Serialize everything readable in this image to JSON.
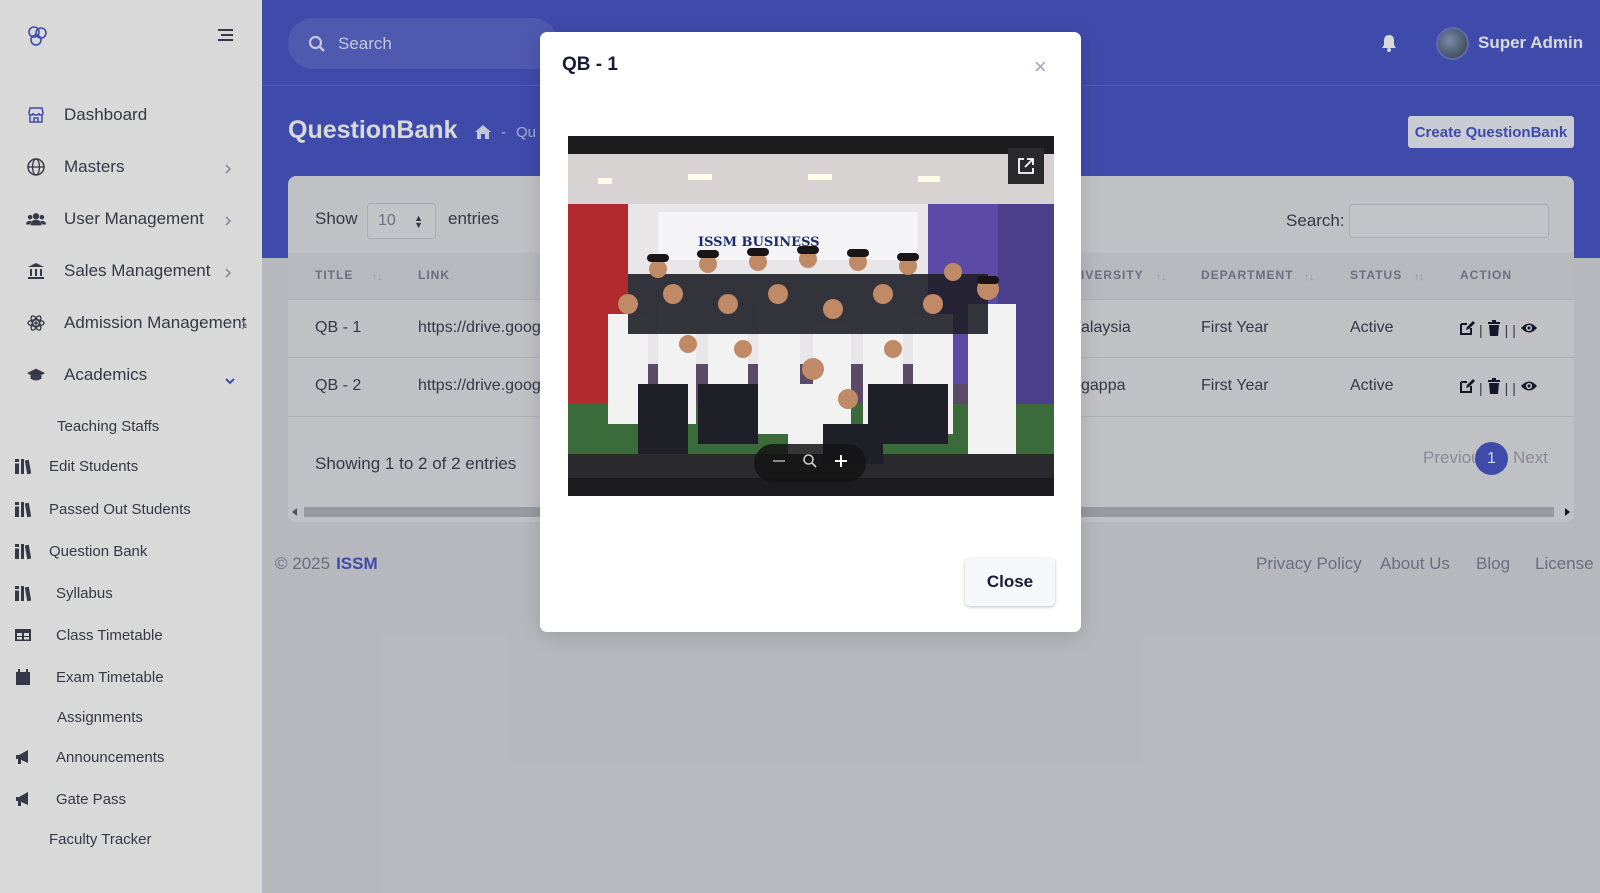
{
  "sidebar": {
    "items": [
      {
        "label": "Dashboard",
        "icon": "store-icon"
      },
      {
        "label": "Masters",
        "icon": "globe-icon"
      },
      {
        "label": "User Management",
        "icon": "users-icon"
      },
      {
        "label": "Sales Management",
        "icon": "bank-icon"
      },
      {
        "label": "Admission Management",
        "icon": "atom-icon"
      },
      {
        "label": "Academics",
        "icon": "graduation-cap-icon"
      }
    ],
    "academics_sub": [
      {
        "label": "Teaching Staffs"
      },
      {
        "label": "Edit Students",
        "icon": "books-icon"
      },
      {
        "label": "Passed Out Students",
        "icon": "books-icon"
      },
      {
        "label": "Question Bank",
        "icon": "books-icon"
      },
      {
        "label": "Syllabus",
        "icon": "books-icon"
      },
      {
        "label": "Class Timetable",
        "icon": "table-icon"
      },
      {
        "label": "Exam Timetable",
        "icon": "calendar-icon"
      },
      {
        "label": "Assignments"
      },
      {
        "label": "Announcements",
        "icon": "megaphone-icon"
      },
      {
        "label": "Gate Pass",
        "icon": "megaphone-icon"
      },
      {
        "label": "Faculty Tracker"
      }
    ]
  },
  "header": {
    "search_placeholder": "Search",
    "user_name": "Super Admin"
  },
  "page": {
    "title": "QuestionBank",
    "breadcrumb_sep": "-",
    "breadcrumb_current": "Qu",
    "create_button": "Create QuestionBank"
  },
  "table": {
    "show_label": "Show",
    "page_length": "10",
    "entries_label": "entries",
    "search_label": "Search:",
    "columns": [
      "TITLE",
      "LINK",
      "IVERSITY",
      "DEPARTMENT",
      "STATUS",
      "ACTION"
    ],
    "rows": [
      {
        "title": "QB - 1",
        "link": "https://drive.goog",
        "university": "alaysia",
        "department": "First Year",
        "status": "Active"
      },
      {
        "title": "QB - 2",
        "link": "https://drive.goog",
        "university": "gappa",
        "department": "First Year",
        "status": "Active"
      }
    ],
    "action_sep": "|",
    "info": "Showing 1 to 2 of 2 entries",
    "prev": "Previou",
    "current_page": "1",
    "next": "Next"
  },
  "footer": {
    "copyright": "© 2025",
    "brand": "ISSM",
    "links": [
      "Privacy Policy",
      "About Us",
      "Blog",
      "License"
    ]
  },
  "modal": {
    "title": "QB - 1",
    "close_x": "×",
    "close_button": "Close",
    "photo_banner_text": "ISSM BUSINESS"
  },
  "colors": {
    "accent": "#4b59c9",
    "sidebar_bg": "#ffffff",
    "page_bg": "#d8d9df"
  }
}
